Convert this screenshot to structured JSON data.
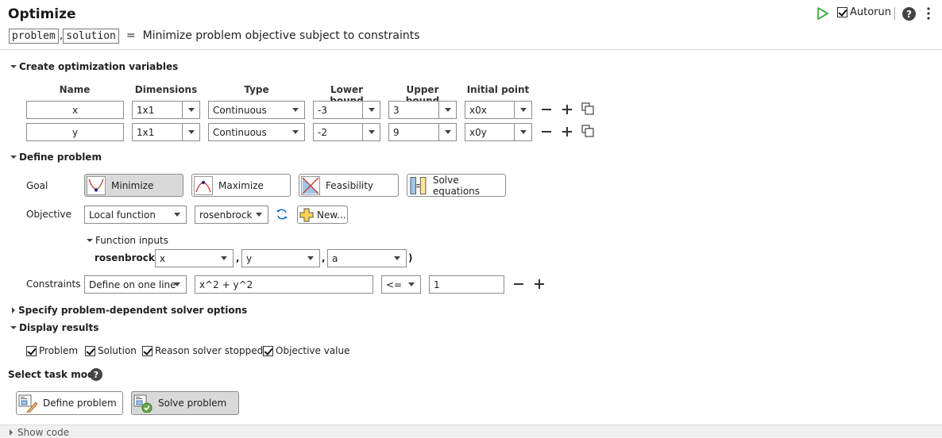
{
  "header": {
    "title": "Optimize",
    "code_problem": "problem",
    "comma": ",",
    "code_solution": "solution",
    "equals": "=",
    "description": "Minimize problem objective subject to constraints",
    "autorun_label": "Autorun",
    "autorun_checked": true
  },
  "variables": {
    "section_label": "Create optimization variables",
    "columns": [
      "Name",
      "Dimensions",
      "Type",
      "Lower bound",
      "Upper bound",
      "Initial point"
    ],
    "rows": [
      {
        "name": "x",
        "dimensions": "1x1",
        "type": "Continuous",
        "lower": "-3",
        "upper": "3",
        "initial": "x0x"
      },
      {
        "name": "y",
        "dimensions": "1x1",
        "type": "Continuous",
        "lower": "-2",
        "upper": "9",
        "initial": "x0y"
      }
    ]
  },
  "define": {
    "section_label": "Define problem",
    "goal_label": "Goal",
    "goals": [
      "Minimize",
      "Maximize",
      "Feasibility",
      "Solve equations"
    ],
    "selected_goal": "Minimize",
    "objective_label": "Objective",
    "objective_type": "Local function",
    "objective_function": "rosenbrock",
    "new_label": "New...",
    "function_inputs_label": "Function inputs",
    "function_call_name": "rosenbrock (",
    "inputs": [
      "x",
      "y",
      "a"
    ],
    "sep_comma": ",",
    "close_paren": ")",
    "constraints_label": "Constraints",
    "constraint_mode": "Define on one line",
    "constraint_expr": "x^2 + y^2",
    "constraint_op": "<=",
    "constraint_rhs": "1"
  },
  "solver_options": {
    "section_label": "Specify problem-dependent solver options"
  },
  "display": {
    "section_label": "Display results",
    "options": [
      "Problem",
      "Solution",
      "Reason solver stopped",
      "Objective value"
    ]
  },
  "task_mode": {
    "label": "Select task mode",
    "buttons": [
      "Define problem",
      "Solve problem"
    ],
    "selected": "Solve problem"
  },
  "footer": {
    "show_code": "Show code"
  },
  "colors": {
    "accent": "#2fa52f",
    "selected_button": "#d9d9d9",
    "border": "#8c8c8c"
  }
}
